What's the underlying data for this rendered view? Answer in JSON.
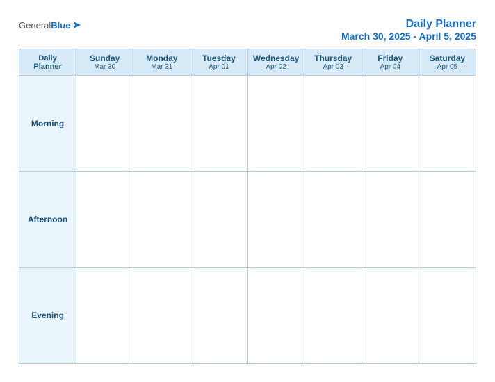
{
  "header": {
    "logo_general": "General",
    "logo_blue": "Blue",
    "title": "Daily Planner",
    "date_range": "March 30, 2025 - April 5, 2025"
  },
  "table": {
    "header_left_line1": "Daily",
    "header_left_line2": "Planner",
    "columns": [
      {
        "day": "Sunday",
        "date": "Mar 30"
      },
      {
        "day": "Monday",
        "date": "Mar 31"
      },
      {
        "day": "Tuesday",
        "date": "Apr 01"
      },
      {
        "day": "Wednesday",
        "date": "Apr 02"
      },
      {
        "day": "Thursday",
        "date": "Apr 03"
      },
      {
        "day": "Friday",
        "date": "Apr 04"
      },
      {
        "day": "Saturday",
        "date": "Apr 05"
      }
    ],
    "rows": [
      {
        "label": "Morning"
      },
      {
        "label": "Afternoon"
      },
      {
        "label": "Evening"
      }
    ]
  }
}
